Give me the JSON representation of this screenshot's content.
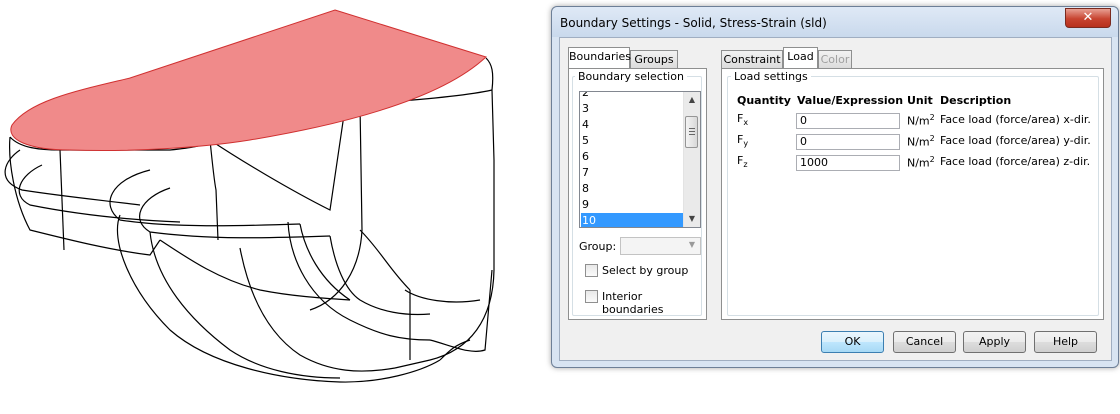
{
  "dialog": {
    "title": "Boundary Settings - Solid, Stress-Strain (sld)",
    "close_symbol": "✕"
  },
  "left_tabs": [
    "Boundaries",
    "Groups"
  ],
  "boundary_selection": {
    "label": "Boundary selection",
    "items": [
      "2",
      "3",
      "4",
      "5",
      "6",
      "7",
      "8",
      "9",
      "10"
    ],
    "selected": "10"
  },
  "group_field": {
    "label": "Group:",
    "value": ""
  },
  "checkboxes": {
    "select_by_group": {
      "label": "Select by group",
      "checked": false
    },
    "interior_boundaries": {
      "label": "Interior boundaries",
      "checked": false
    }
  },
  "right_tabs": [
    {
      "label": "Constraint",
      "state": "normal"
    },
    {
      "label": "Load",
      "state": "active"
    },
    {
      "label": "Color",
      "state": "disabled"
    }
  ],
  "load_settings": {
    "label": "Load settings",
    "headers": {
      "quantity": "Quantity",
      "value": "Value/Expression",
      "unit": "Unit",
      "description": "Description"
    },
    "rows": [
      {
        "symbol": "F",
        "subscript": "x",
        "value": "0",
        "unit": "N/m",
        "unit_exp": "2",
        "description": "Face load (force/area) x-dir."
      },
      {
        "symbol": "F",
        "subscript": "y",
        "value": "0",
        "unit": "N/m",
        "unit_exp": "2",
        "description": "Face load (force/area) y-dir."
      },
      {
        "symbol": "F",
        "subscript": "z",
        "value": "1000",
        "unit": "N/m",
        "unit_exp": "2",
        "description": "Face load (force/area) z-dir."
      }
    ]
  },
  "buttons": {
    "ok": "OK",
    "cancel": "Cancel",
    "apply": "Apply",
    "help": "Help"
  },
  "colors": {
    "highlight_face": "#f08a8a",
    "selection": "#3399ff"
  }
}
